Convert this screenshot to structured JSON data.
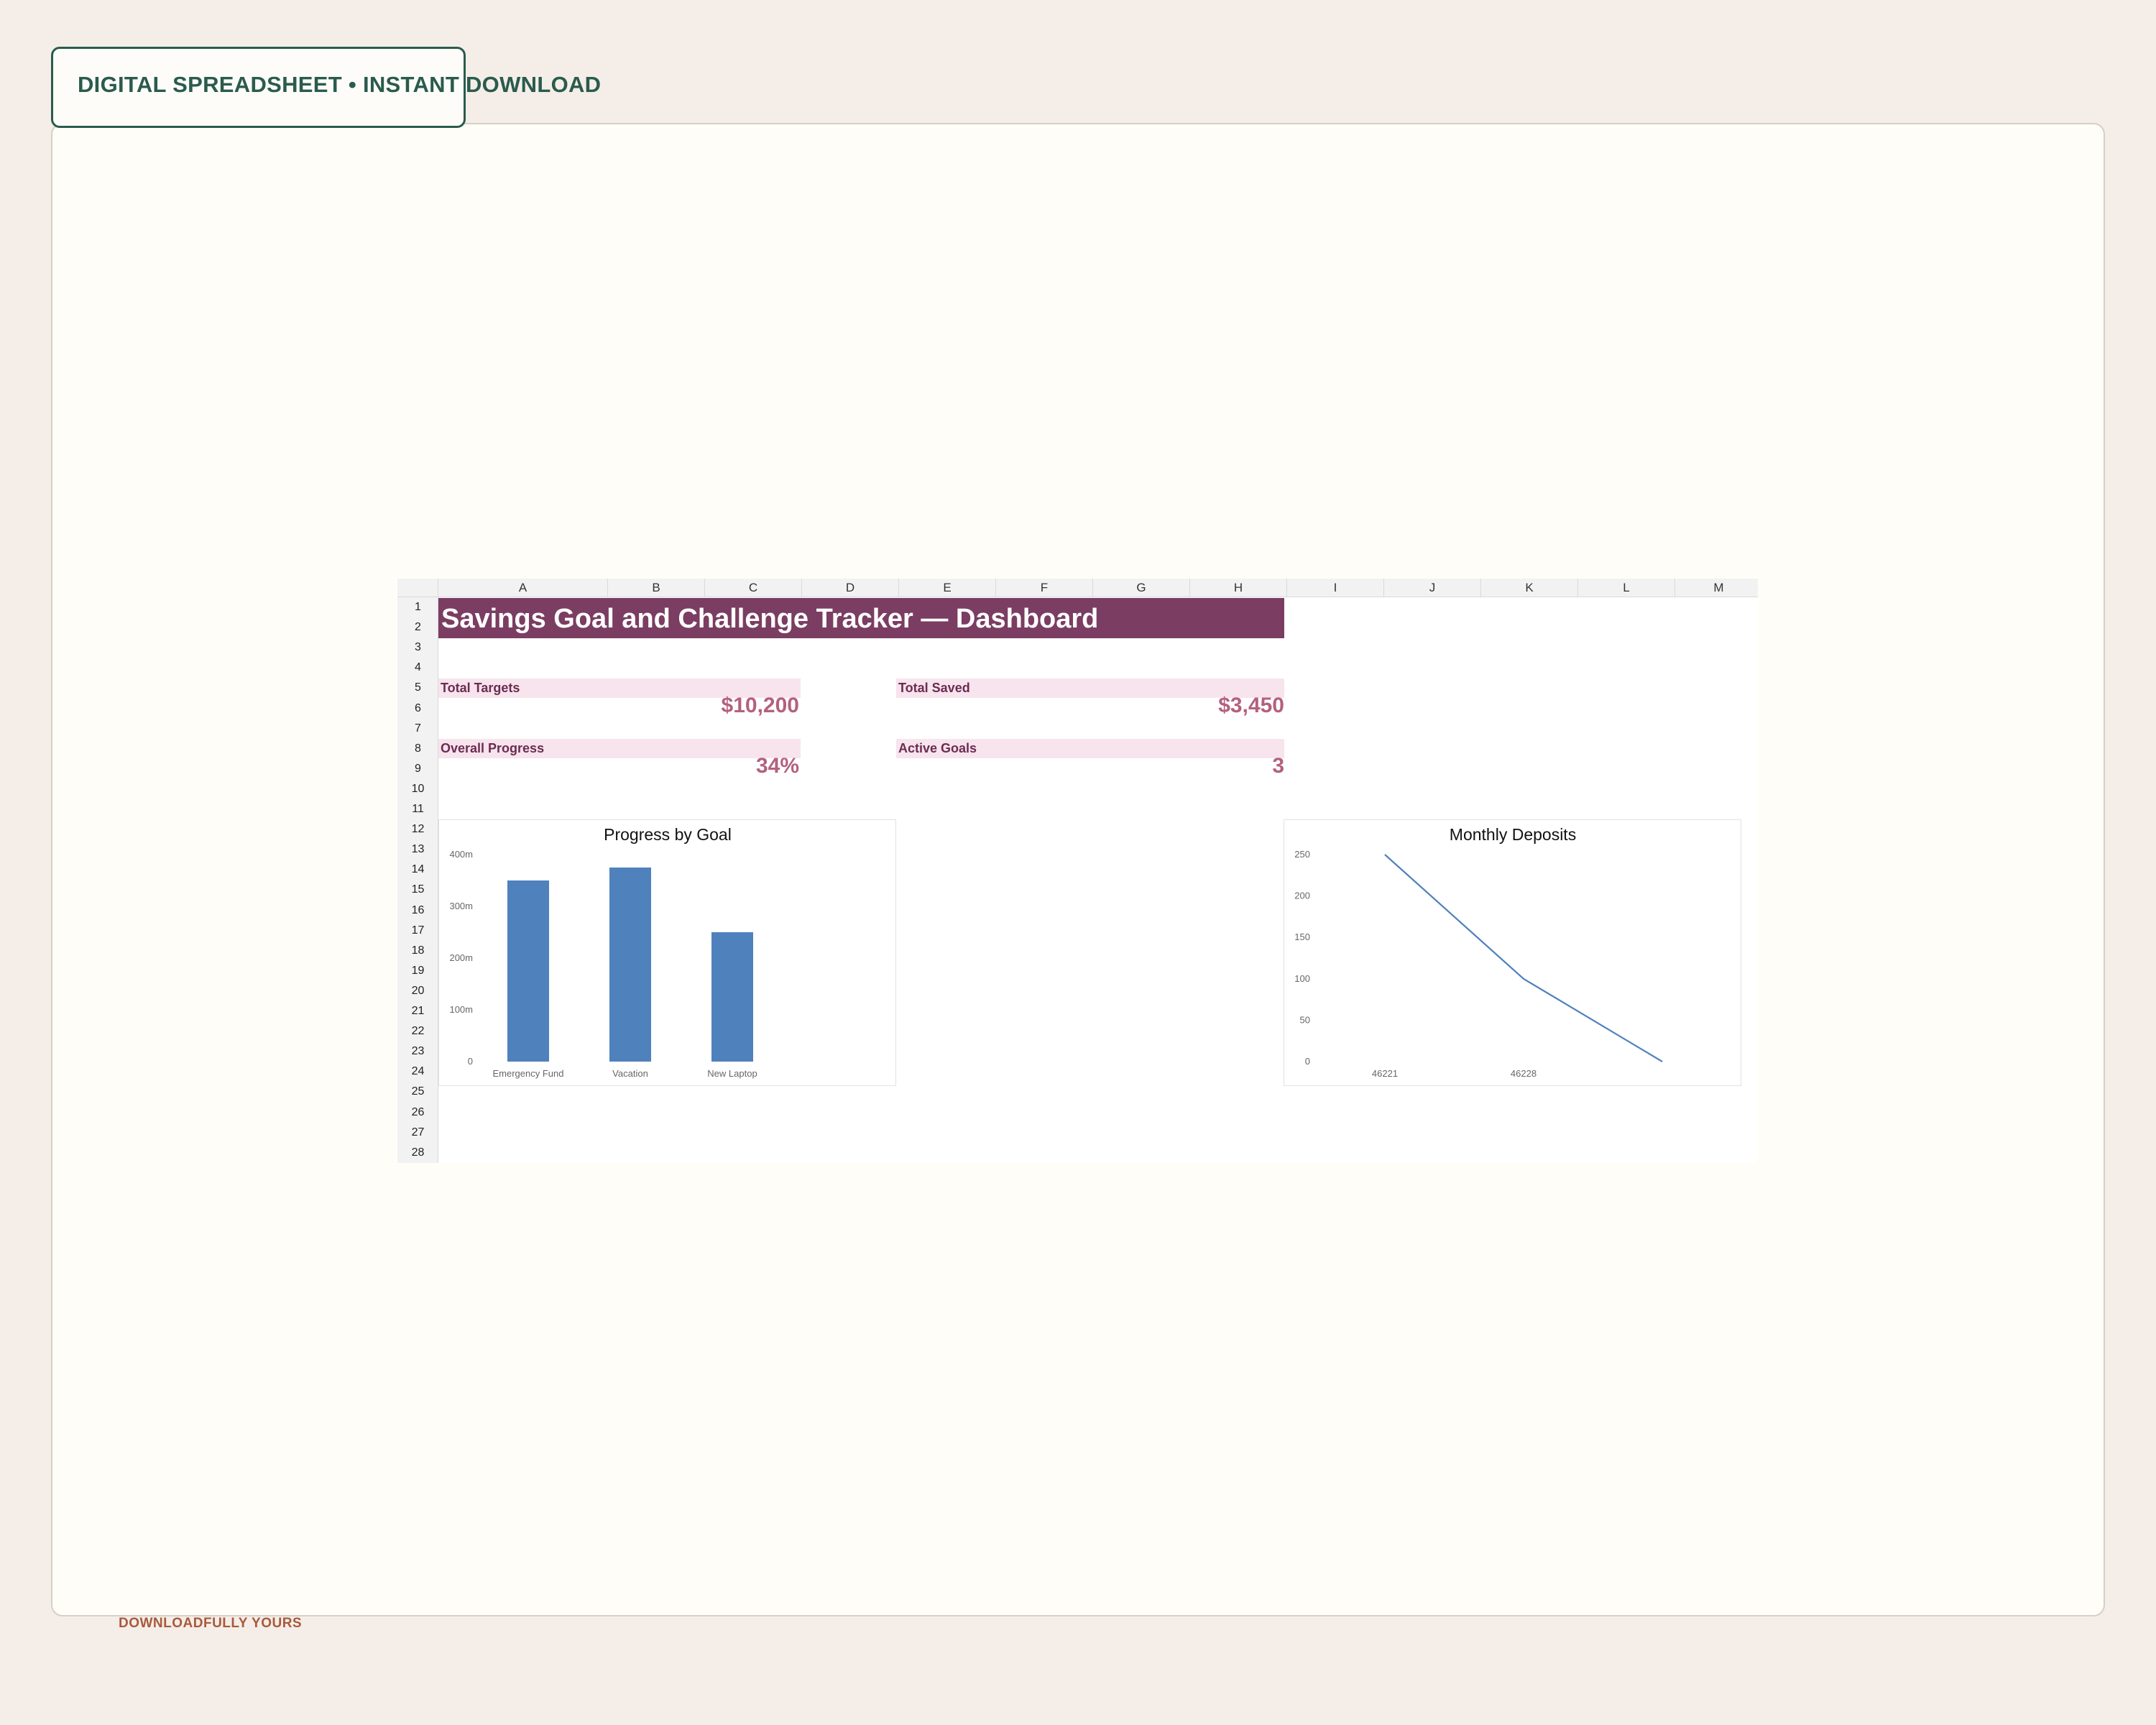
{
  "badge": {
    "label": "DIGITAL SPREADSHEET • INSTANT DOWNLOAD"
  },
  "footer": {
    "brand": "DOWNLOADFULLY YOURS"
  },
  "sheet": {
    "columns": [
      "A",
      "B",
      "C",
      "D",
      "E",
      "F",
      "G",
      "H",
      "I",
      "J",
      "K",
      "L",
      "M"
    ],
    "rows": [
      "1",
      "2",
      "3",
      "4",
      "5",
      "6",
      "7",
      "8",
      "9",
      "10",
      "11",
      "12",
      "13",
      "14",
      "15",
      "16",
      "17",
      "18",
      "19",
      "20",
      "21",
      "22",
      "23",
      "24",
      "25",
      "26",
      "27",
      "28"
    ],
    "title": "Savings Goal and Challenge Tracker — Dashboard",
    "kpis": {
      "total_targets": {
        "label": "Total Targets",
        "value": "$10,200"
      },
      "total_saved": {
        "label": "Total Saved",
        "value": "$3,450"
      },
      "overall_progress": {
        "label": "Overall Progress",
        "value": "34%"
      },
      "active_goals": {
        "label": "Active Goals",
        "value": "3"
      }
    },
    "colors": {
      "title_band": "#7b3d62",
      "kpi_label_bg": "#f7e4ed",
      "kpi_value": "#b4607f",
      "series": "#4f81bd"
    }
  },
  "chart_data": [
    {
      "type": "bar",
      "title": "Progress by Goal",
      "categories": [
        "Emergency Fund",
        "Vacation",
        "New Laptop"
      ],
      "values": [
        0.35,
        0.375,
        0.25
      ],
      "ylim": [
        0,
        0.4
      ],
      "yticks": [
        0,
        0.1,
        0.2,
        0.3,
        0.4
      ],
      "ytick_labels": [
        "0",
        "100m",
        "200m",
        "300m",
        "400m"
      ],
      "xlabel": "",
      "ylabel": "",
      "grid": false
    },
    {
      "type": "line",
      "title": "Monthly Deposits",
      "x": [
        46221,
        46228,
        46235
      ],
      "y": [
        250,
        100,
        0
      ],
      "ylim": [
        0,
        250
      ],
      "yticks": [
        0,
        50,
        100,
        150,
        200,
        250
      ],
      "xtick_labels": [
        "46221",
        "46228"
      ],
      "xlabel": "",
      "ylabel": "",
      "grid": false
    }
  ]
}
